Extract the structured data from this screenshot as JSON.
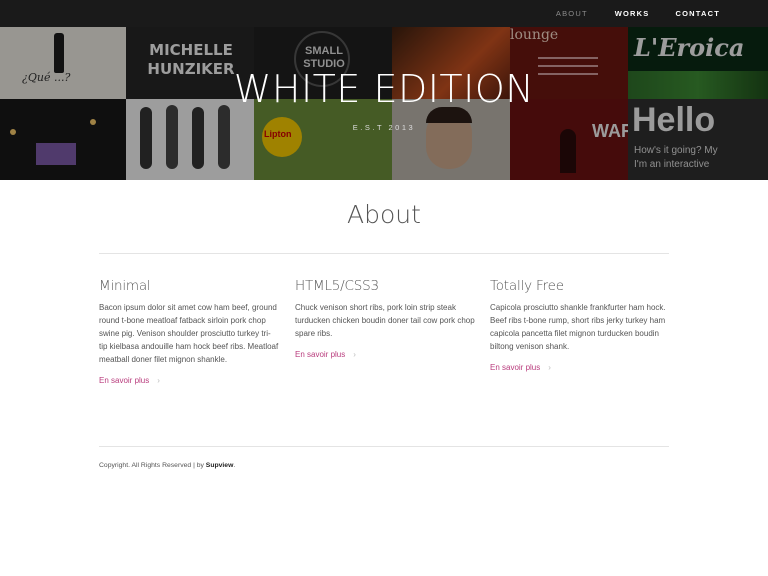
{
  "nav": {
    "items": [
      "ABOUT",
      "WORKS",
      "CONTACT"
    ]
  },
  "hero": {
    "title": "WHITE EDITION",
    "subtitle": "E.S.T 2013",
    "tiles": {
      "michelle": "MICHELLE HUNZIKER",
      "small_studio": "SMALL STUDIO",
      "lounge": "lounge",
      "eroica": "L'Eroica",
      "hello": "Hello",
      "hello_sub1": "How's it going? My",
      "hello_sub2": "I'm an interactive",
      "quel": "¿Qué ...?",
      "lipton": "Lipton",
      "war": "WAR"
    }
  },
  "about": {
    "title": "About",
    "columns": [
      {
        "title": "Minimal",
        "text": "Bacon ipsum dolor sit amet cow ham beef, ground round t-bone meatloaf fatback sirloin pork chop swine pig. Venison shoulder prosciutto turkey tri-tip kielbasa andouille ham hock beef ribs. Meatloaf meatball doner filet mignon shankle.",
        "link": "En savoir plus"
      },
      {
        "title": "HTML5/CSS3",
        "text": "Chuck venison short ribs, pork loin strip steak turducken chicken boudin doner tail cow pork chop spare ribs.",
        "link": "En savoir plus"
      },
      {
        "title": "Totally Free",
        "text": "Capicola prosciutto shankle frankfurter ham hock. Beef ribs t-bone rump, short ribs jerky turkey ham capicola pancetta filet mignon turducken boudin biltong venison shank.",
        "link": "En savoir plus"
      }
    ]
  },
  "footer": {
    "text": "Copyright. All Rights Reserved | by",
    "brand": "Supview"
  },
  "colors": {
    "accent": "#b93c7d",
    "nav_bg": "#1a1a1a"
  }
}
